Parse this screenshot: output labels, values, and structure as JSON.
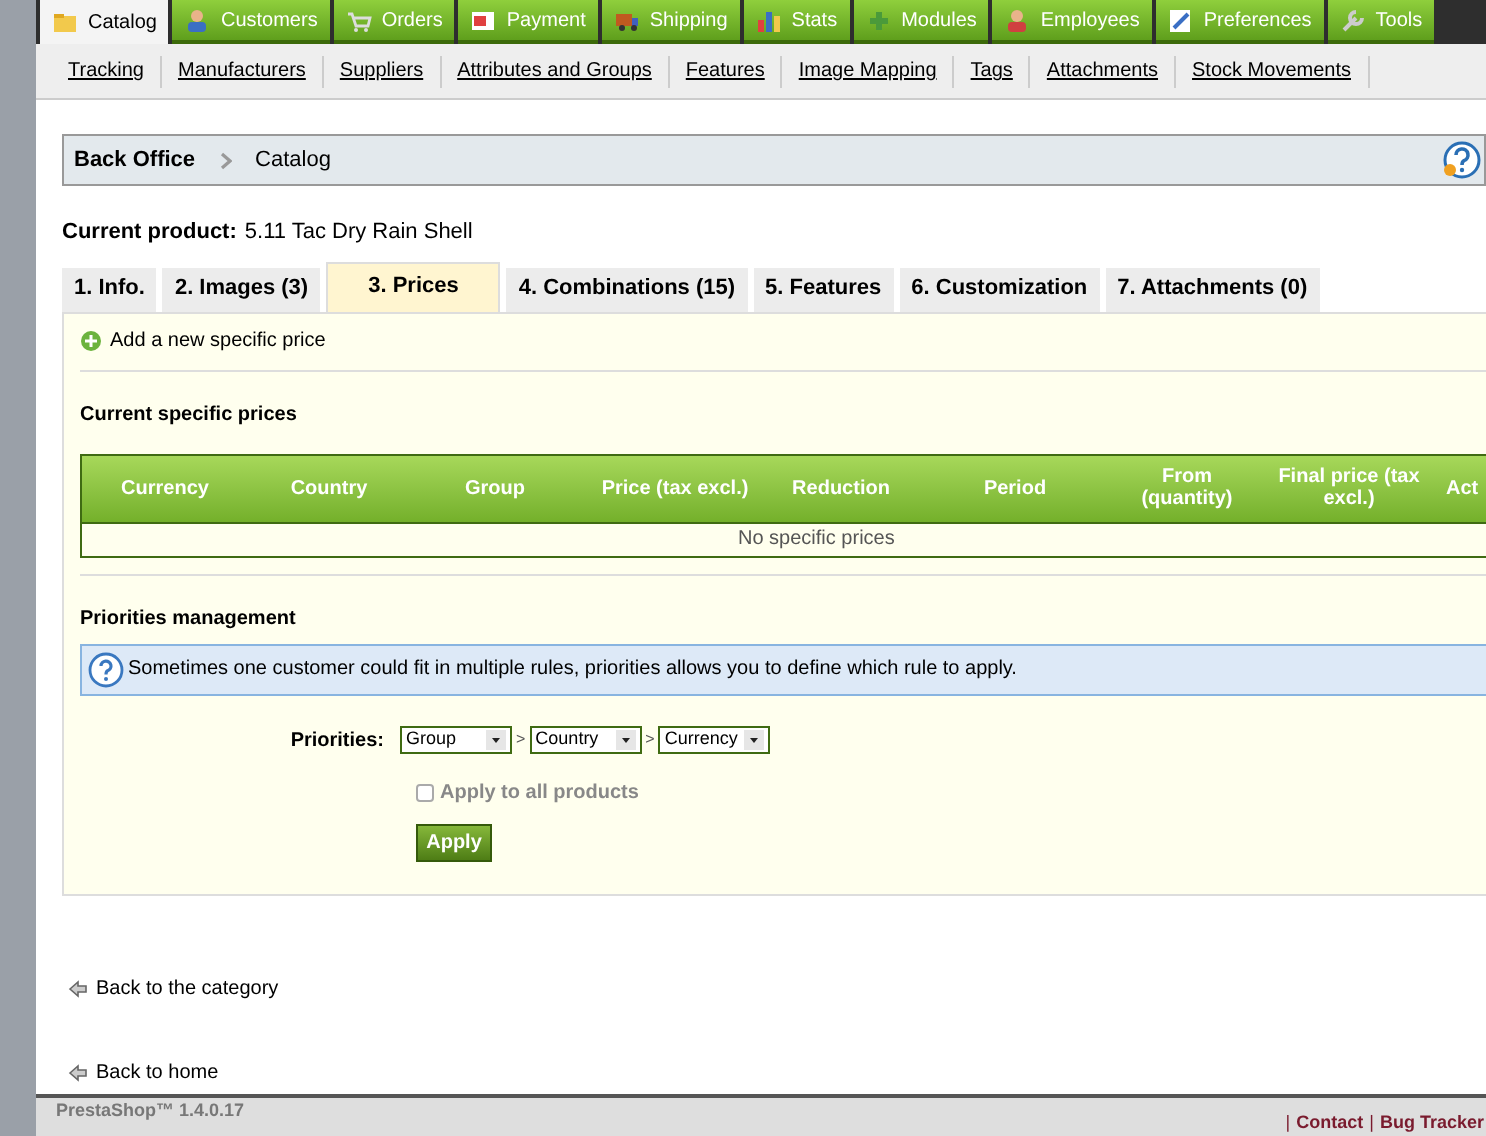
{
  "main_menu": [
    {
      "label": "Catalog",
      "selected": true
    },
    {
      "label": "Customers",
      "selected": false
    },
    {
      "label": "Orders",
      "selected": false
    },
    {
      "label": "Payment",
      "selected": false
    },
    {
      "label": "Shipping",
      "selected": false
    },
    {
      "label": "Stats",
      "selected": false
    },
    {
      "label": "Modules",
      "selected": false
    },
    {
      "label": "Employees",
      "selected": false
    },
    {
      "label": "Preferences",
      "selected": false
    },
    {
      "label": "Tools",
      "selected": false
    }
  ],
  "sub_menu": [
    "Tracking",
    "Manufacturers",
    "Suppliers",
    "Attributes and Groups",
    "Features",
    "Image Mapping",
    "Tags",
    "Attachments",
    "Stock Movements"
  ],
  "breadcrumb": [
    "Back Office",
    "Catalog"
  ],
  "current_product": {
    "label": "Current product:",
    "value": "5.11 Tac Dry Rain Shell"
  },
  "tabs": [
    {
      "label": "1. Info.",
      "selected": false
    },
    {
      "label": "2. Images (3)",
      "selected": false
    },
    {
      "label": "3. Prices",
      "selected": true
    },
    {
      "label": "4. Combinations (15)",
      "selected": false
    },
    {
      "label": "5. Features",
      "selected": false
    },
    {
      "label": "6. Customization",
      "selected": false
    },
    {
      "label": "7. Attachments (0)",
      "selected": false
    }
  ],
  "add_link": "Add a new specific price",
  "specific_prices": {
    "title": "Current specific prices",
    "columns": [
      "Currency",
      "Country",
      "Group",
      "Price (tax excl.)",
      "Reduction",
      "Period",
      "From (quantity)",
      "Final price (tax excl.)",
      "Act"
    ],
    "empty_message": "No specific prices"
  },
  "priorities": {
    "title": "Priorities management",
    "hint": "Sometimes one customer could fit in multiple rules, priorities allows you to define which rule to apply.",
    "label": "Priorities:",
    "selects": [
      "Group",
      "Country",
      "Currency"
    ],
    "separators": [
      ">",
      ">"
    ],
    "apply_all": {
      "label": "Apply to all products",
      "checked": false
    },
    "button": "Apply"
  },
  "back_links": [
    "Back to the category",
    "Back to home"
  ],
  "footer": {
    "version": "PrestaShop™ 1.4.0.17",
    "links": [
      "Contact",
      "Bug Tracker"
    ],
    "separators": [
      "|",
      "|"
    ]
  }
}
